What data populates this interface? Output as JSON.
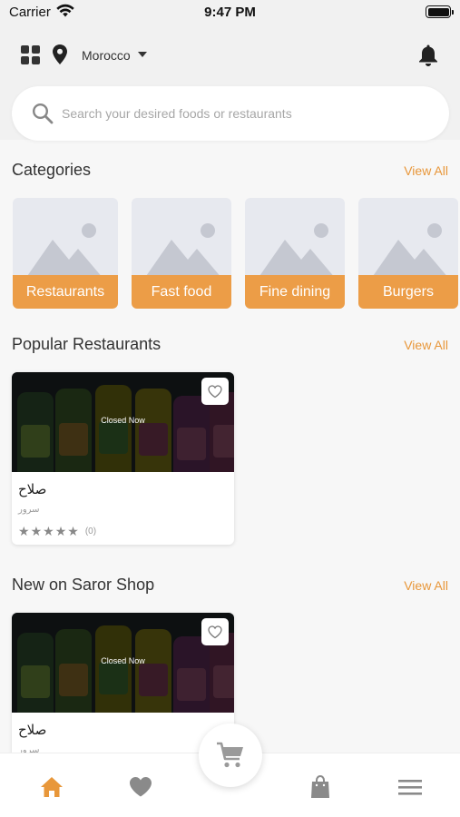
{
  "status_bar": {
    "carrier": "Carrier",
    "time": "9:47 PM"
  },
  "header": {
    "location": "Morocco"
  },
  "search": {
    "placeholder": "Search your desired foods or restaurants"
  },
  "categories": {
    "title": "Categories",
    "view_all": "View All",
    "items": [
      {
        "label": "Restaurants"
      },
      {
        "label": "Fast food"
      },
      {
        "label": "Fine dining"
      },
      {
        "label": "Burgers"
      }
    ]
  },
  "popular": {
    "title": "Popular Restaurants",
    "view_all": "View All",
    "items": [
      {
        "status": "Closed Now",
        "name": "صلاح",
        "subtitle": "سرور",
        "rating_count": "(0)"
      }
    ]
  },
  "new_shop": {
    "title": "New on Saror Shop",
    "view_all": "View All",
    "items": [
      {
        "status": "Closed Now",
        "name": "صلاح",
        "subtitle": "سرور"
      }
    ]
  },
  "tab_bar": {
    "tabs": [
      {
        "icon": "home-icon",
        "active": true
      },
      {
        "icon": "heart-icon",
        "active": false
      },
      {
        "icon": "cart-icon",
        "active": false
      },
      {
        "icon": "bag-icon",
        "active": false
      },
      {
        "icon": "menu-icon",
        "active": false
      }
    ]
  },
  "colors": {
    "accent": "#e8973a",
    "category_label_bg": "#ec9d47",
    "background": "#f7f7f7"
  }
}
